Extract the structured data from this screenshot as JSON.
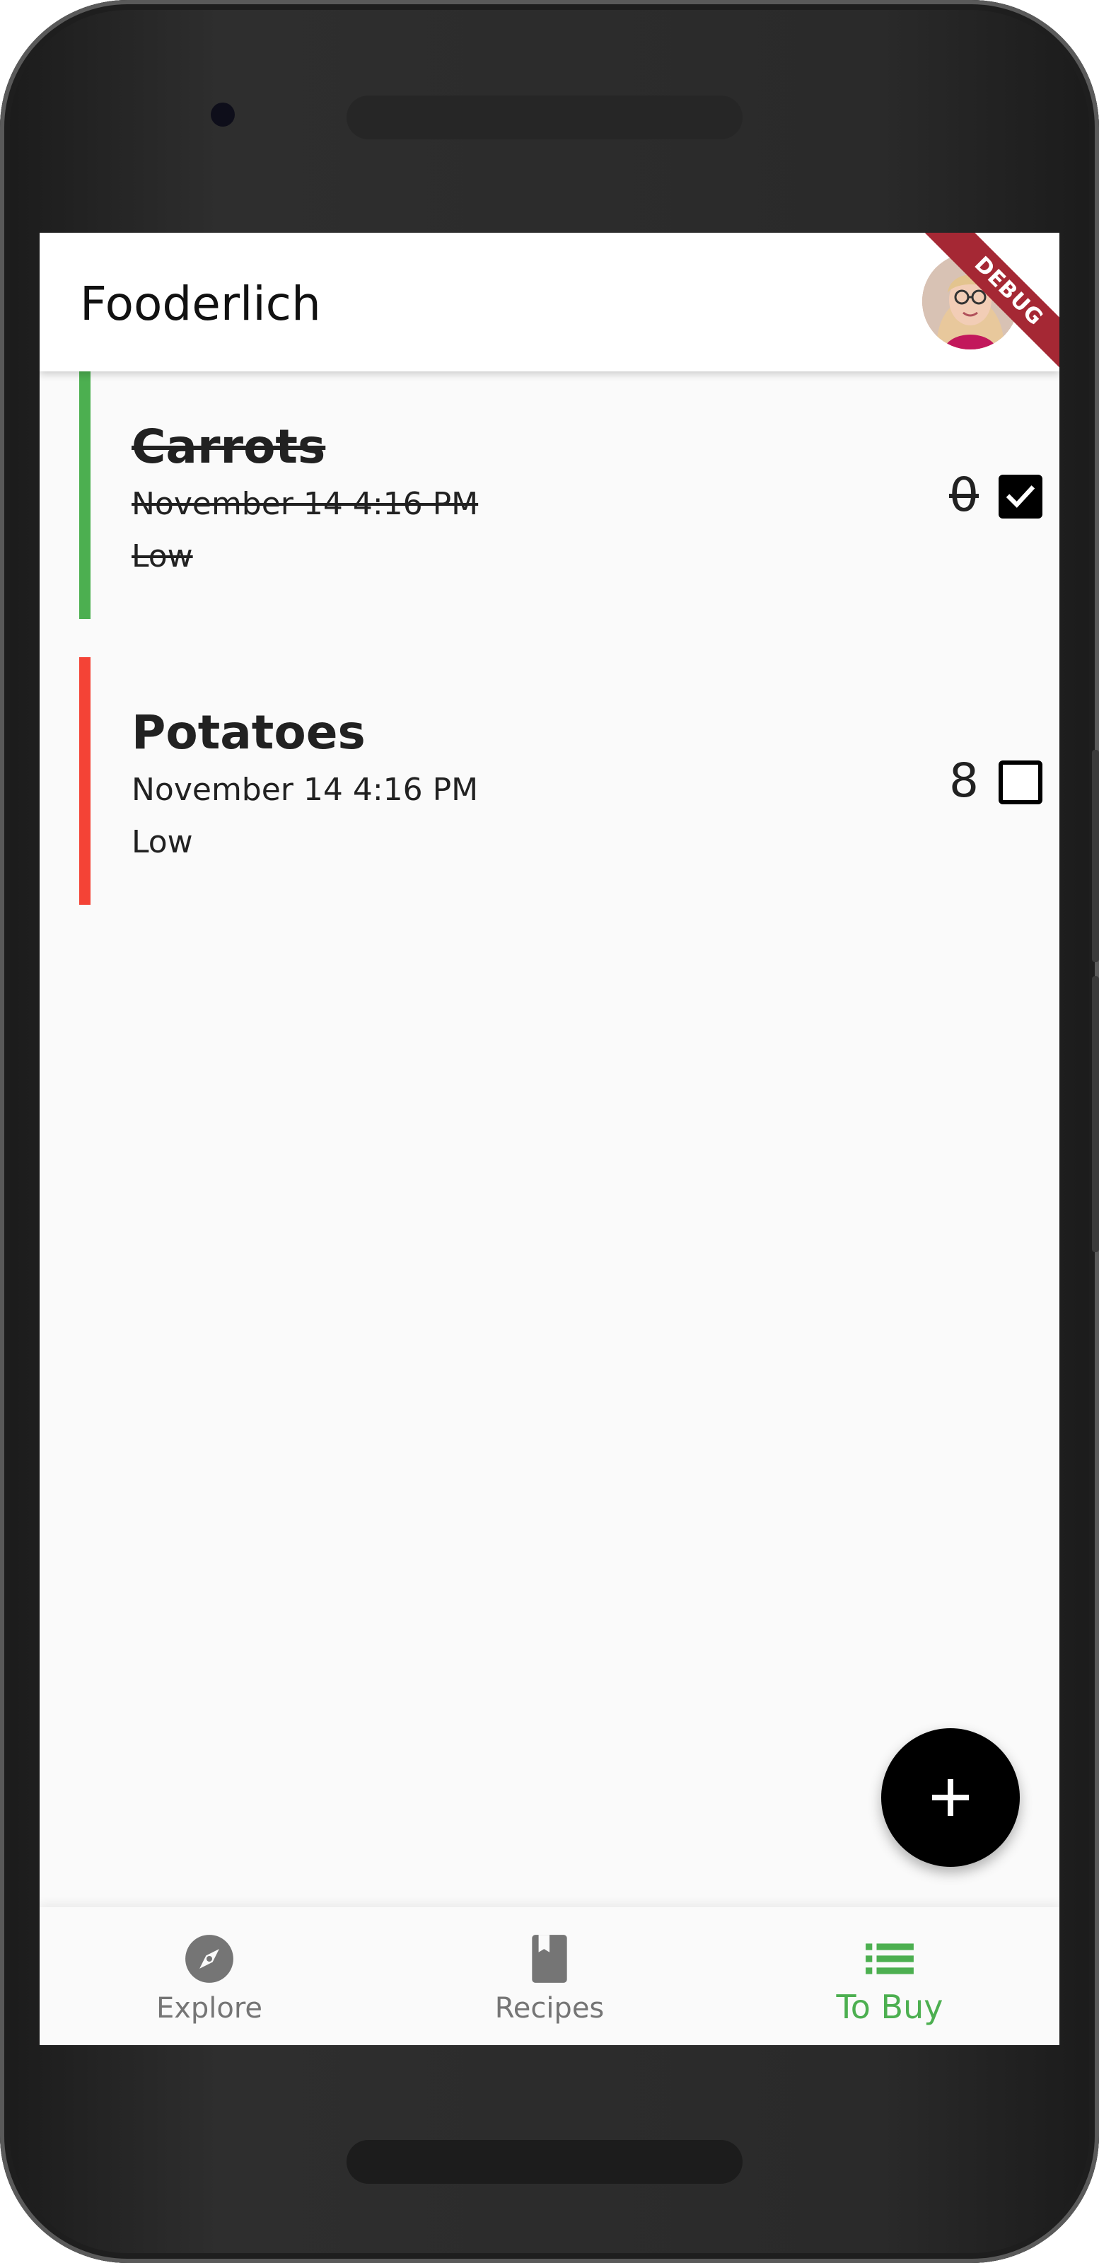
{
  "app": {
    "title": "Fooderlich",
    "debug_banner": "DEBUG"
  },
  "items": [
    {
      "name": "Carrots",
      "date": "November 14 4:16 PM",
      "importance": "Low",
      "quantity": "0",
      "checked": true,
      "color": "#4caf50"
    },
    {
      "name": "Potatoes",
      "date": "November 14 4:16 PM",
      "importance": "Low",
      "quantity": "8",
      "checked": false,
      "color": "#f44336"
    }
  ],
  "fab": {
    "icon": "plus-icon"
  },
  "bottom_nav": {
    "items": [
      {
        "label": "Explore",
        "icon": "compass-icon",
        "active": false
      },
      {
        "label": "Recipes",
        "icon": "book-icon",
        "active": false
      },
      {
        "label": "To Buy",
        "icon": "list-icon",
        "active": true
      }
    ],
    "active_color": "#4caf50",
    "inactive_color": "#757575"
  }
}
